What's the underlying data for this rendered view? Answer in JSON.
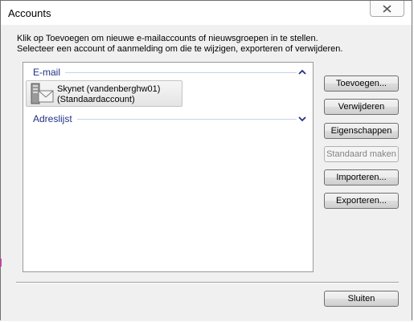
{
  "window": {
    "title": "Accounts",
    "close_icon": "close-icon"
  },
  "instructions": {
    "line1": "Klik op Toevoegen om nieuwe e-mailaccounts of nieuwsgroepen in te stellen.",
    "line2": "Selecteer een account of aanmelding om die te wijzigen, exporteren of verwijderen."
  },
  "groups": {
    "email": {
      "label": "E-mail",
      "chevron_icon": "chevron-up-icon",
      "accounts": [
        {
          "name": "Skynet (vandenberghw01)",
          "subtitle": "(Standaardaccount)",
          "icon": "mail-server-icon"
        }
      ]
    },
    "address_book": {
      "label": "Adreslijst",
      "chevron_icon": "chevron-down-icon"
    }
  },
  "buttons": {
    "add": "Toevoegen...",
    "remove": "Verwijderen",
    "properties": "Eigenschappen",
    "set_default": "Standaard maken",
    "import": "Importeren...",
    "export": "Exporteren...",
    "close": "Sluiten"
  },
  "states": {
    "set_default_disabled": true
  }
}
